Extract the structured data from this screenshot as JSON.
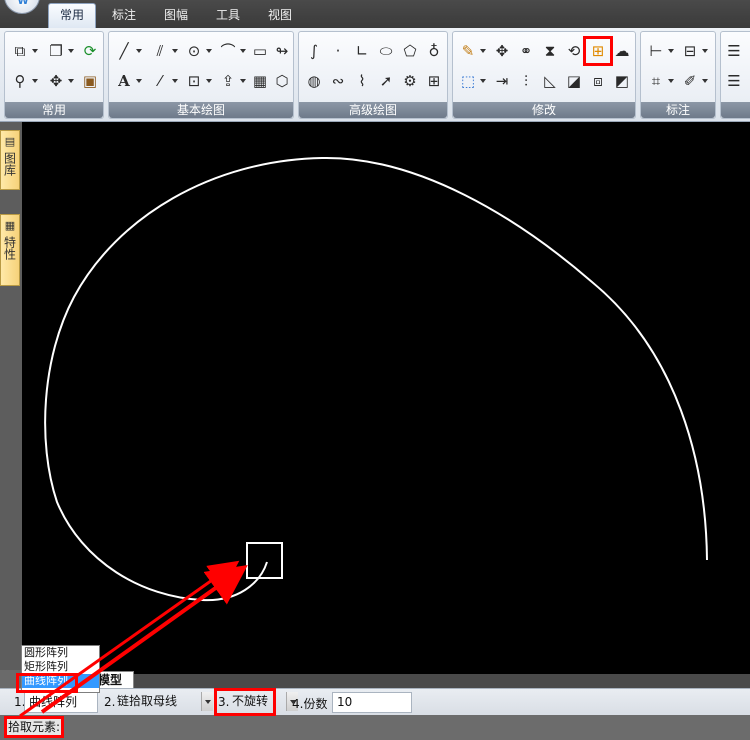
{
  "menu": {
    "tabs": [
      "常用",
      "标注",
      "图幅",
      "工具",
      "视图"
    ],
    "active_tab": "常用"
  },
  "ribbon": {
    "groups": [
      "常用",
      "基本绘图",
      "高级绘图",
      "修改",
      "标注"
    ],
    "highlighted_tool": "array-tool"
  },
  "side_panels": [
    "图库",
    "特性"
  ],
  "canvas": {
    "background": "#000000",
    "curve_color": "#ffffff",
    "pick_box_color": "#ffffff"
  },
  "model_tab": "模型",
  "array_menu": {
    "options": [
      "圆形阵列",
      "矩形阵列",
      "曲线阵列"
    ],
    "selected": "曲线阵列"
  },
  "property_bar": {
    "field1_index": "1.",
    "field1_value": "曲线阵列",
    "field2_index": "2.",
    "field2_value": "链拾取母线",
    "field3_index": "3.",
    "field3_value": "不旋转",
    "field4_label": "4.份数",
    "field4_value": "10"
  },
  "status": {
    "prompt": "拾取元素:"
  },
  "annotation_color": "#ff0000"
}
